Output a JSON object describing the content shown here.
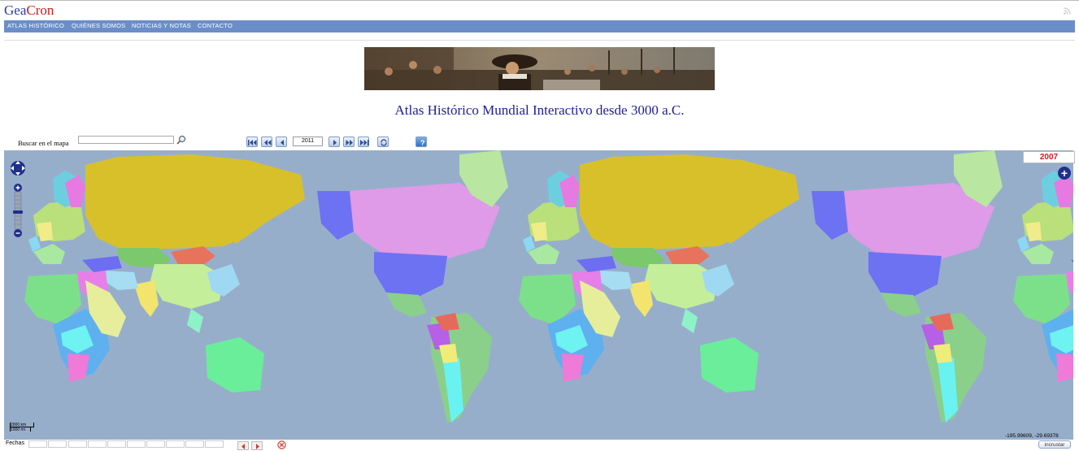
{
  "logo": {
    "part1": "Gea",
    "part2": "Cron"
  },
  "nav": [
    {
      "label": "ATLAS HISTÓRICO"
    },
    {
      "label": "QUIÉNES SOMOS"
    },
    {
      "label": "NOTICIAS Y NOTAS"
    },
    {
      "label": "CONTACTO"
    }
  ],
  "page_title": "Atlas Histórico Mundial Interactivo desde 3000 a.C.",
  "search": {
    "label": "Buscar en el mapa",
    "value": ""
  },
  "year_input": "2011",
  "map": {
    "year_label": "2007",
    "scale_km": "2000 km",
    "scale_mi": "1000 mi",
    "coords": "-195.99609, -29.69378",
    "ocean_color": "#97aecb"
  },
  "bottom": {
    "dates_label": "Fechas",
    "embed_label": "incrustar"
  },
  "colors": {
    "nav_bar": "#6b8ec9",
    "title": "#1d1d9b",
    "year": "#cc1b1b",
    "logo_blue": "#2a3aa8",
    "logo_red": "#cc1b1b"
  }
}
